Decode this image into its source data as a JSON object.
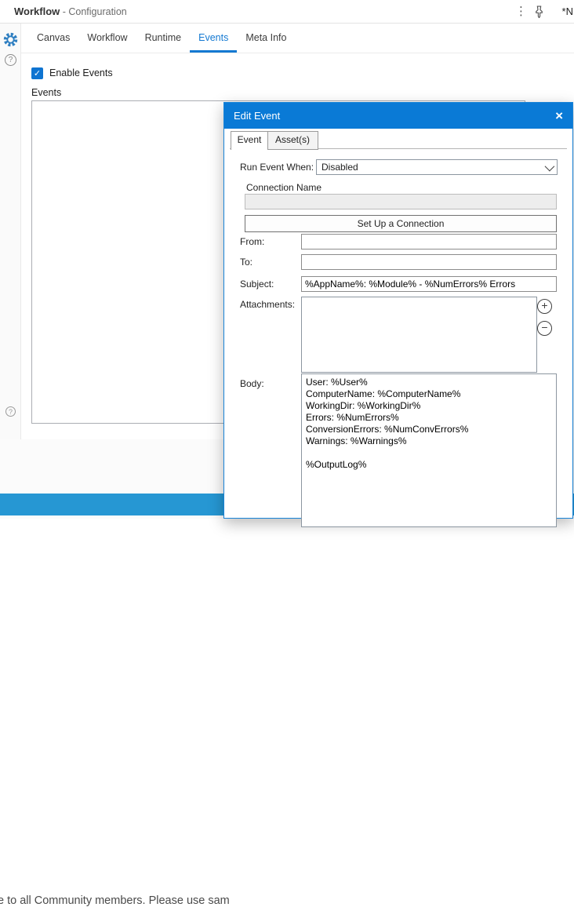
{
  "window": {
    "title_primary": "Workflow",
    "title_secondary": " - Configuration",
    "unsaved_hint": "*N"
  },
  "config_tabs": [
    {
      "label": "Canvas",
      "active": false
    },
    {
      "label": "Workflow",
      "active": false
    },
    {
      "label": "Runtime",
      "active": false
    },
    {
      "label": "Events",
      "active": true
    },
    {
      "label": "Meta Info",
      "active": false
    }
  ],
  "events_panel": {
    "enable_events_label": "Enable Events",
    "enable_events_checked": true,
    "events_list_label": "Events"
  },
  "dialog": {
    "title": "Edit Event",
    "tabs": [
      {
        "label": "Event",
        "active": true
      },
      {
        "label": "Asset(s)",
        "active": false
      }
    ],
    "run_event_when": {
      "label": "Run Event When:",
      "value": "Disabled"
    },
    "connection": {
      "label": "Connection Name",
      "value": "",
      "button_label": "Set Up a Connection"
    },
    "from": {
      "label": "From:",
      "value": ""
    },
    "to": {
      "label": "To:",
      "value": ""
    },
    "subject": {
      "label": "Subject:",
      "value": "%AppName%: %Module% - %NumErrors% Errors"
    },
    "attachments": {
      "label": "Attachments:"
    },
    "body": {
      "label": "Body:",
      "value": "User: %User%\nComputerName: %ComputerName%\nWorkingDir: %WorkingDir%\nErrors: %NumErrors%\nConversionErrors: %NumConvErrors%\nWarnings: %Warnings%\n\n%OutputLog%"
    }
  },
  "background": {
    "community_text": "e to all Community members. Please use sam"
  },
  "icons": {
    "check": "✓",
    "close": "×",
    "more": "⋮",
    "plus": "+",
    "minus": "−",
    "help": "?"
  },
  "colors": {
    "accent_blue": "#0a7ad6",
    "tab_active_blue": "#1479d2",
    "banner_blue": "#2697d3"
  }
}
